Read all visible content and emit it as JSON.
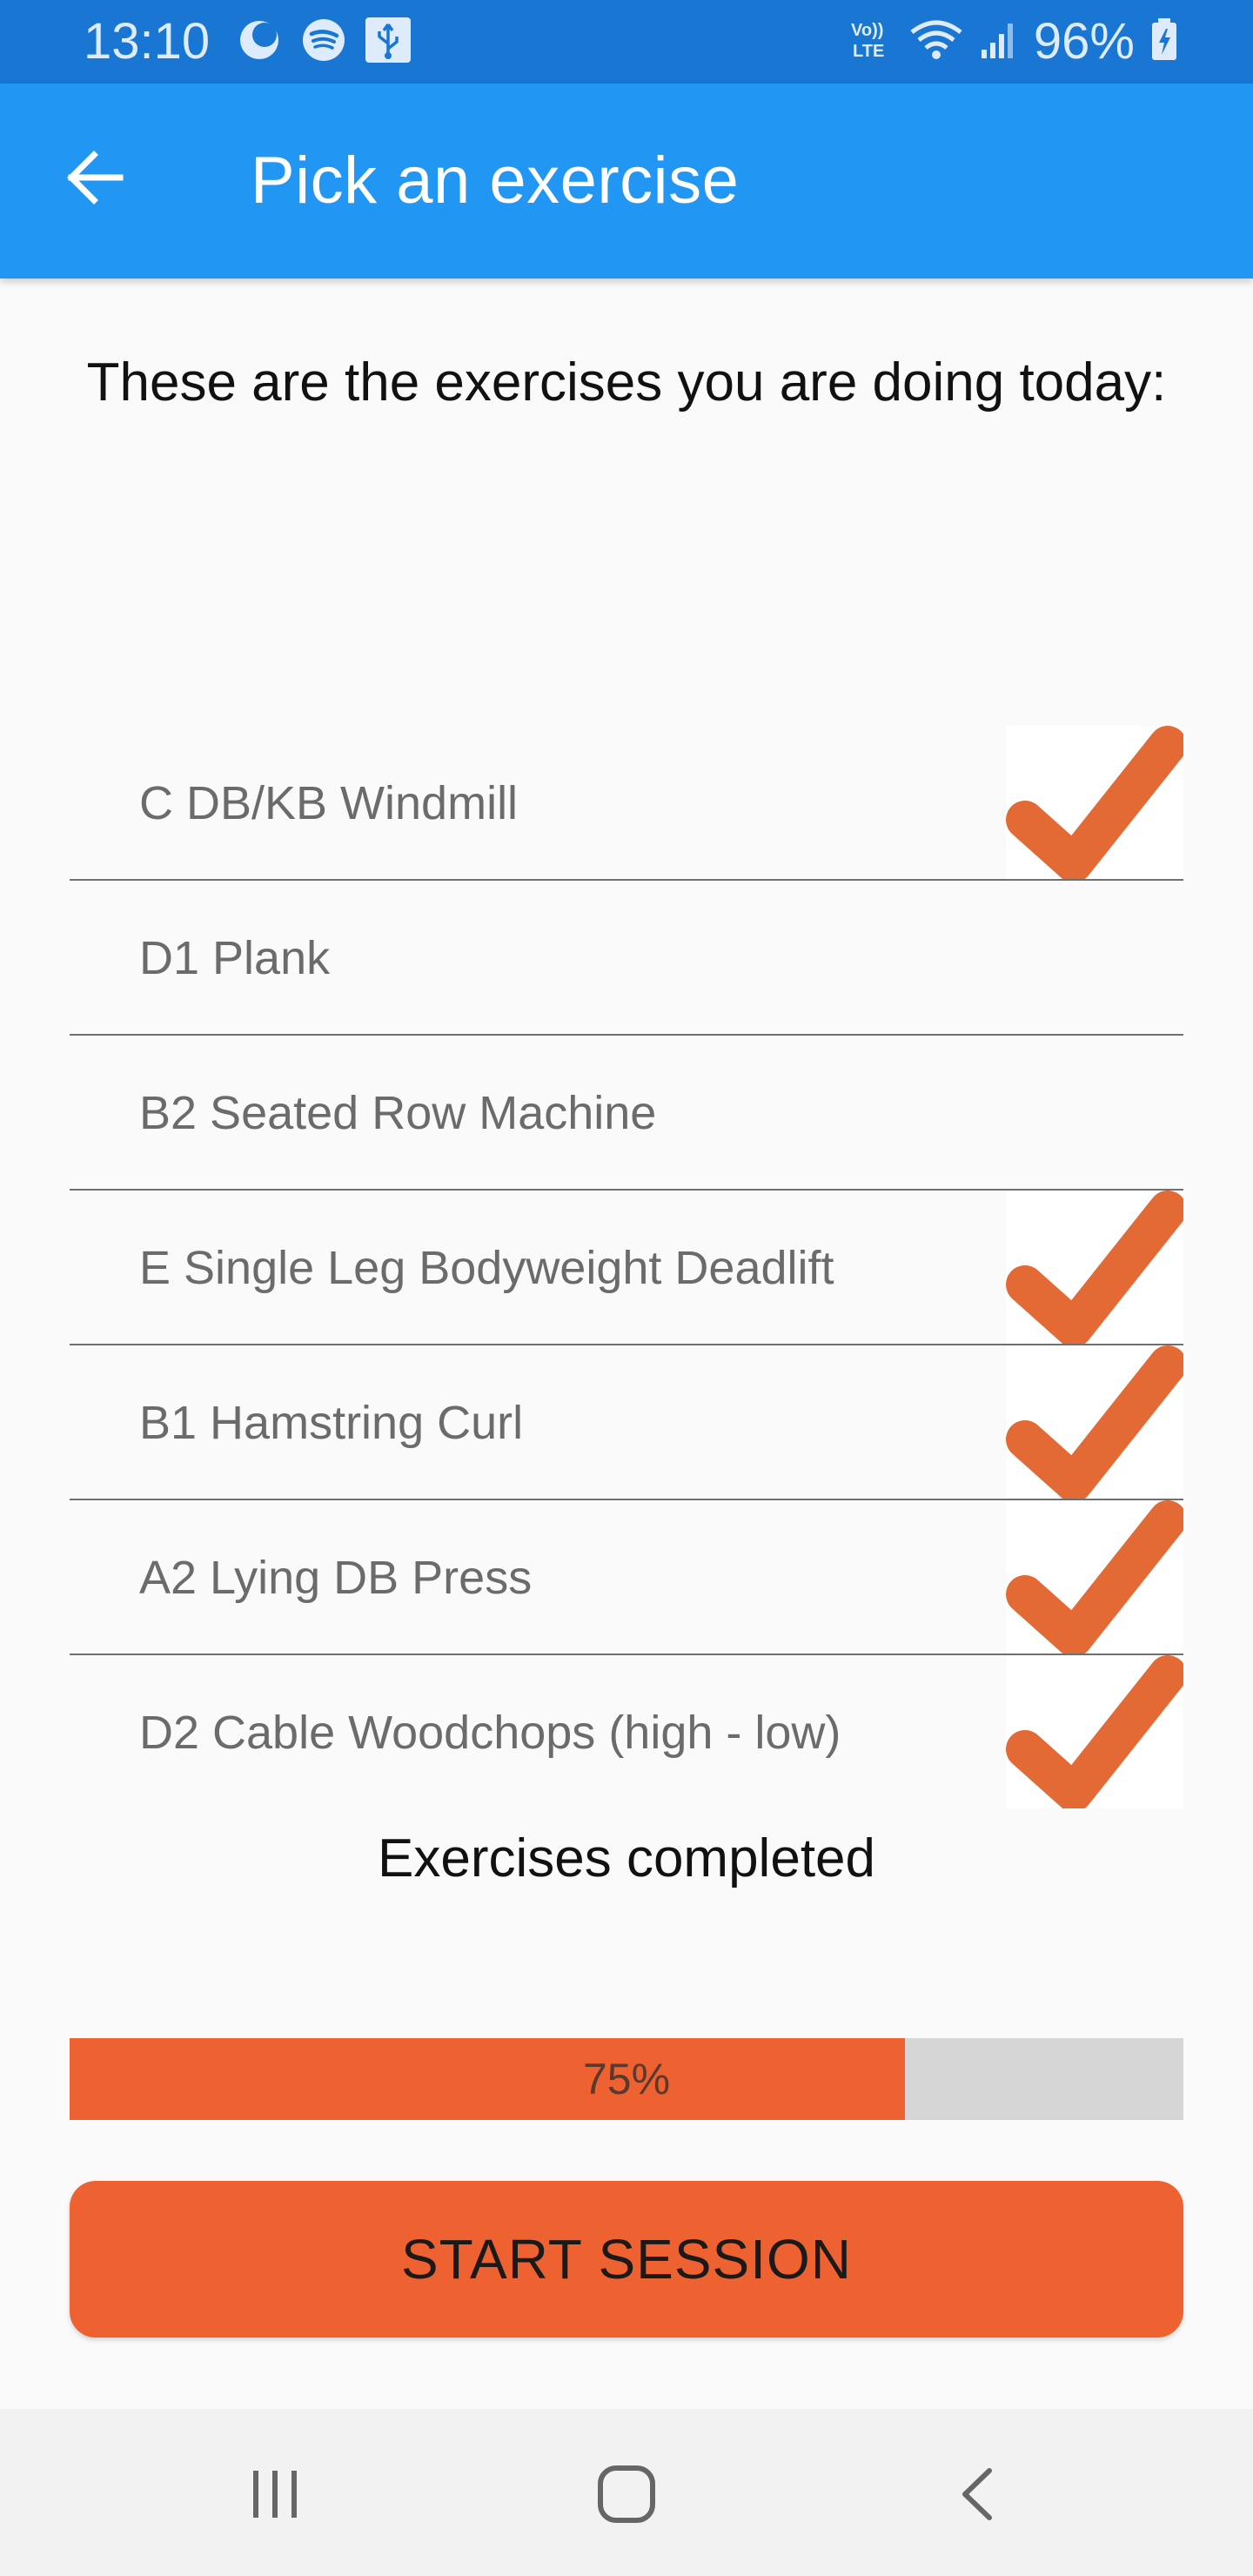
{
  "status_bar": {
    "time": "13:10",
    "battery": "96%",
    "left_icons": [
      "moon-icon",
      "spotify-icon",
      "usb-icon"
    ],
    "right_icons": [
      "volte-icon",
      "wifi-icon",
      "signal-icon",
      "battery-charging-icon"
    ],
    "background": "#1976D2"
  },
  "app_bar": {
    "title": "Pick an exercise",
    "back_icon": "arrow-left-icon",
    "background": "#2196F3"
  },
  "intro": "These are the exercises you are doing today:",
  "exercises": [
    {
      "label": "C DB/KB Windmill",
      "completed": true
    },
    {
      "label": "D1 Plank",
      "completed": false
    },
    {
      "label": "B2 Seated Row Machine",
      "completed": false
    },
    {
      "label": "E Single Leg Bodyweight Deadlift",
      "completed": true
    },
    {
      "label": "B1 Hamstring Curl",
      "completed": true
    },
    {
      "label": "A2 Lying DB Press",
      "completed": true
    },
    {
      "label": "D2 Cable Woodchops (high - low)",
      "completed": true
    }
  ],
  "check_icon": "checkmark-icon",
  "accent_color": "#EE6130",
  "check_color": "#E36A35",
  "completed_label": "Exercises completed",
  "progress": {
    "value": 0.75,
    "text": "75%"
  },
  "start_button_label": "START SESSION",
  "nav_bar": {
    "buttons": [
      "recent-apps-icon",
      "home-icon",
      "back-icon"
    ]
  }
}
